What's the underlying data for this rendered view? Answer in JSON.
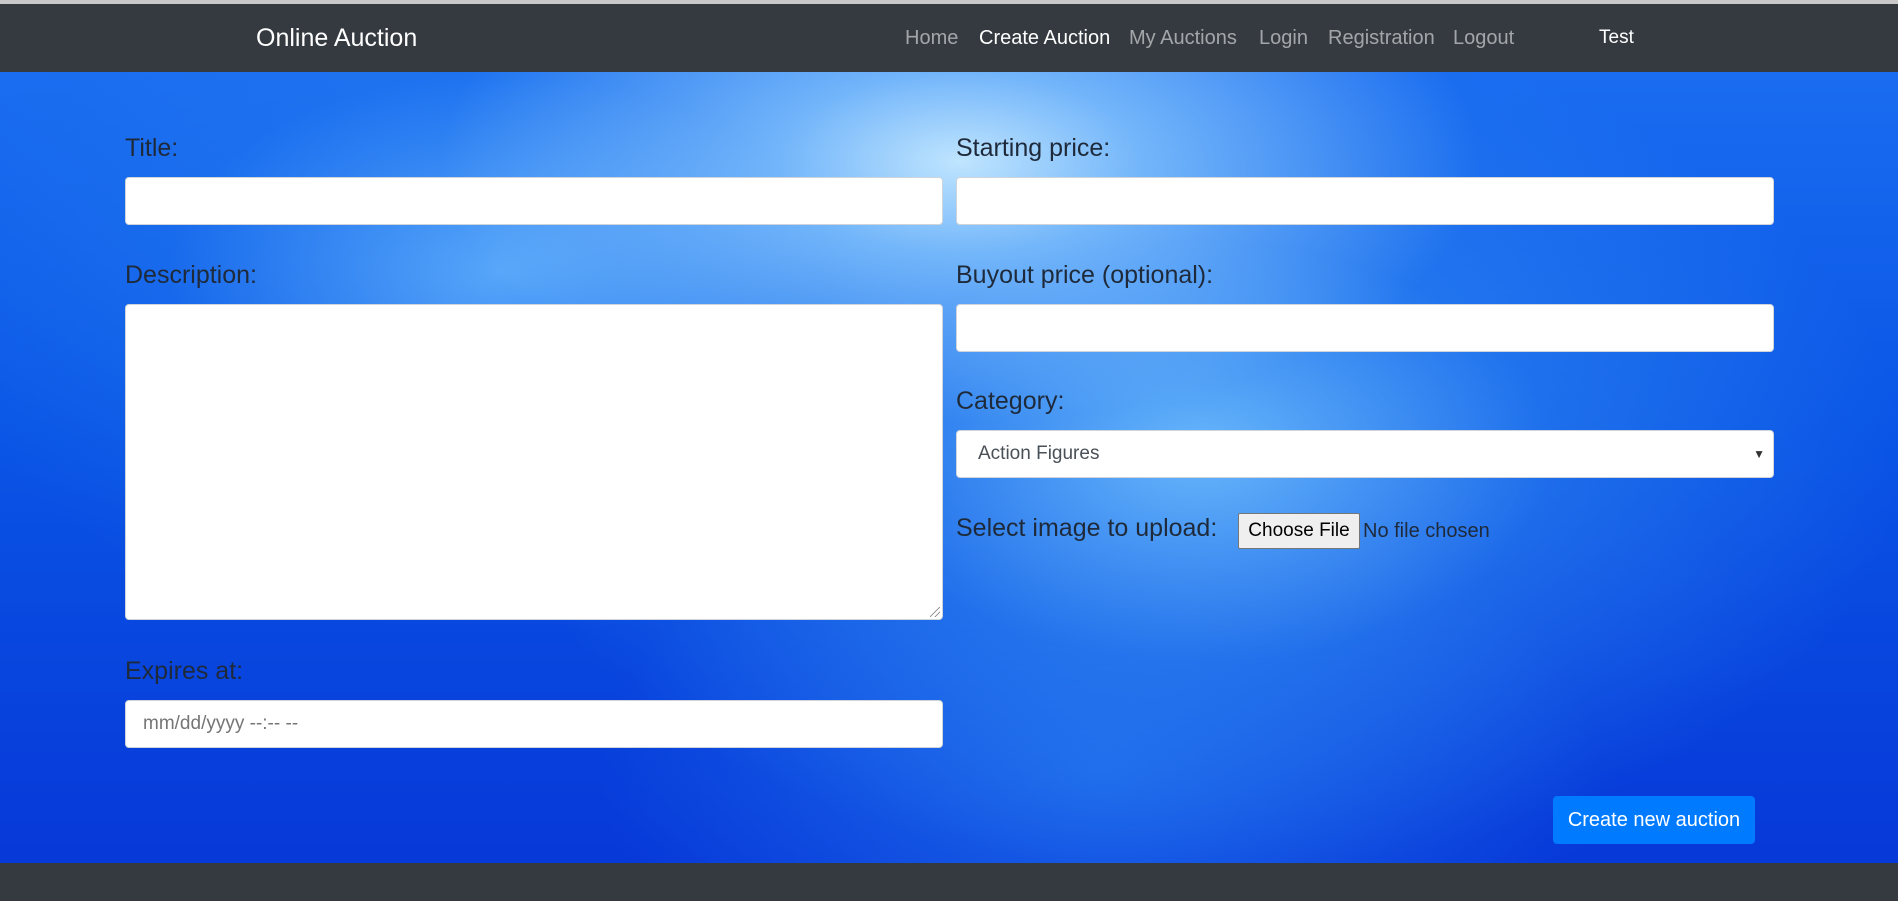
{
  "navbar": {
    "brand": "Online Auction",
    "links": [
      {
        "label": "Home",
        "active": false
      },
      {
        "label": "Create Auction",
        "active": true
      },
      {
        "label": "My Auctions",
        "active": false
      },
      {
        "label": "Login",
        "active": false
      },
      {
        "label": "Registration",
        "active": false
      },
      {
        "label": "Logout",
        "active": false
      }
    ],
    "user": "Test"
  },
  "form": {
    "title_label": "Title:",
    "title_value": "",
    "starting_price_label": "Starting price:",
    "starting_price_value": "",
    "description_label": "Description:",
    "description_value": "",
    "buyout_label": "Buyout price (optional):",
    "buyout_value": "",
    "category_label": "Category:",
    "category_selected": "Action Figures",
    "image_label": "Select image to upload:",
    "choose_file_label": "Choose File",
    "file_status": "No file chosen",
    "expires_label": "Expires at:",
    "expires_placeholder": "mm/dd/yyyy --:-- --",
    "submit_label": "Create new auction"
  },
  "colors": {
    "navbar_bg": "#343a40",
    "primary": "#007bff",
    "background_blue": "#0a55e6"
  }
}
